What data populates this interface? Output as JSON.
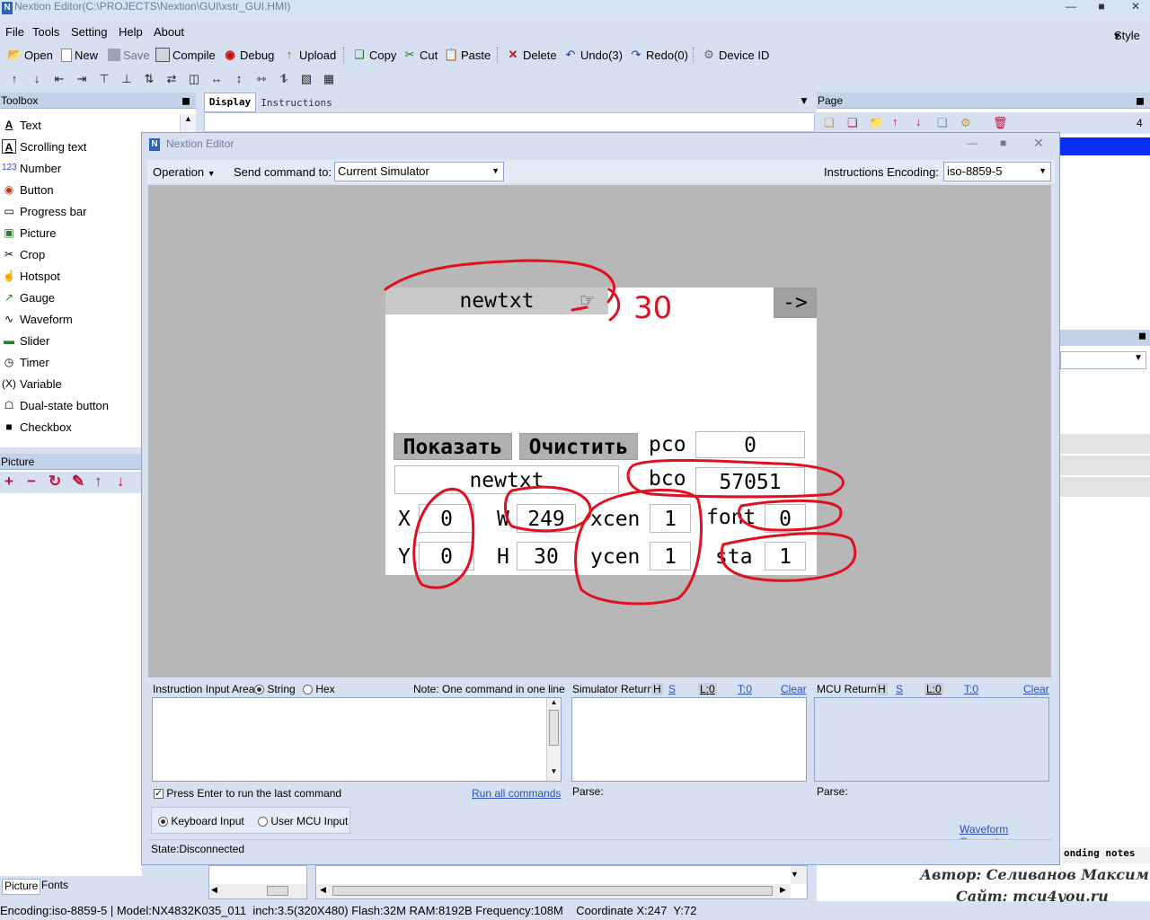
{
  "window": {
    "title": "Nextion Editor(C:\\PROJECTS\\Nextion\\GUI\\xstr_GUI.HMI)",
    "logo": "N"
  },
  "menu": {
    "items": [
      "File",
      "Tools",
      "Setting",
      "Help",
      "About"
    ],
    "style": "Style"
  },
  "toolbar": {
    "open": "Open",
    "new": "New",
    "save": "Save",
    "compile": "Compile",
    "debug": "Debug",
    "upload": "Upload",
    "copy": "Copy",
    "cut": "Cut",
    "paste": "Paste",
    "delete": "Delete",
    "undo": "Undo(3)",
    "redo": "Redo(0)",
    "device_id": "Device  ID"
  },
  "toolbox": {
    "title": "Toolbox",
    "items": [
      "Text",
      "Scrolling text",
      "Number",
      "Button",
      "Progress bar",
      "Picture",
      "Crop",
      "Hotspot",
      "Gauge",
      "Waveform",
      "Slider",
      "Timer",
      "Variable",
      "Dual-state button",
      "Checkbox"
    ],
    "icons": [
      "text-icon",
      "scrolling-text-icon",
      "number-icon",
      "button-icon",
      "progress-bar-icon",
      "picture-icon",
      "crop-icon",
      "hotspot-icon",
      "gauge-icon",
      "waveform-icon",
      "slider-icon",
      "timer-icon",
      "variable-icon",
      "dual-state-button-icon",
      "checkbox-icon"
    ]
  },
  "picture_panel": {
    "title": "Picture"
  },
  "mid_tabs": {
    "display": "Display",
    "instructions": "Instructions"
  },
  "page_panel": {
    "title": "Page",
    "count": "4",
    "footer_text": "onding notes"
  },
  "dialog": {
    "title": "Nextion Editor",
    "operation": "Operation",
    "send_label": "Send command to:",
    "send_value": "Current Simulator",
    "encoding_label": "Instructions Encoding:",
    "encoding_value": "iso-8859-5"
  },
  "screen": {
    "header_text": "newtxt",
    "arrow_btn": "->",
    "btn_show": "Показать",
    "btn_clear": "Очистить",
    "pco_label": "pco",
    "pco_value": "0",
    "input_text": "newtxt",
    "bco_label": "bco",
    "bco_value": "57051",
    "x_label": "X",
    "x_value": "0",
    "w_label": "W",
    "w_value": "249",
    "xcen_label": "xcen",
    "xcen_value": "1",
    "font_label": "font",
    "font_value": "0",
    "y_label": "Y",
    "y_value": "0",
    "h_label": "H",
    "h_value": "30",
    "ycen_label": "ycen",
    "ycen_value": "1",
    "sta_label": "sta",
    "sta_value": "1",
    "annotation_number": "30"
  },
  "bottom": {
    "input_area_label": "Instruction Input Area:",
    "string_label": "String",
    "hex_label": "Hex",
    "note": "Note: One command in one line",
    "enter_label": "Press Enter to run the last command",
    "run_all": "Run all commands",
    "keyboard_input": "Keyboard Input",
    "mcu_input": "User MCU Input",
    "sim_return": "Simulator Return:",
    "mcu_return": "MCU Return:",
    "flag_h": "H",
    "flag_s": "S",
    "flag_l": "L:0",
    "flag_t": "T:0",
    "clear": "Clear",
    "parse": "Parse:",
    "waveform": "Waveform Generator",
    "state": "State:Disconnected"
  },
  "bottom_tabs": {
    "picture": "Picture",
    "fonts": "Fonts"
  },
  "status": {
    "text": "Encoding:iso-8859-5 | Model:NX4832K035_011  inch:3.5(320X480) Flash:32M RAM:8192B Frequency:108M    Coordinate X:247  Y:72"
  },
  "watermark": {
    "line1": "Автор: Селиванов Максим",
    "line2": "Сайт: mcu4you.ru"
  },
  "colors": {
    "annotation": "#e01020",
    "selection": "#0a2ef5"
  }
}
